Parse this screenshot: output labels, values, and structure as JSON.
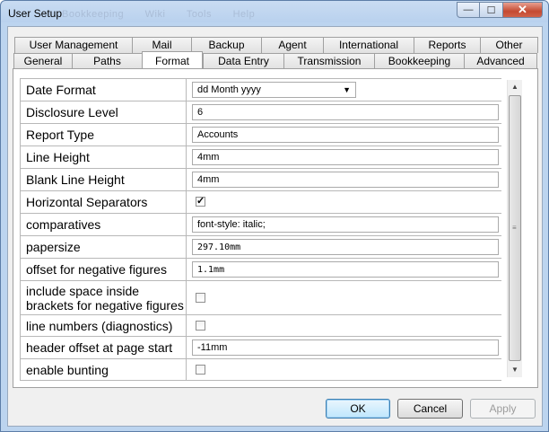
{
  "window": {
    "title": "User Setup",
    "ghost_menu": [
      "Bookkeeping",
      "Wiki",
      "Tools",
      "Help"
    ],
    "buttons": {
      "minimize": "—",
      "maximize": "☐",
      "close": "✕"
    }
  },
  "tabs": {
    "row1": [
      "User   Management",
      "Mail",
      "Backup",
      "Agent",
      "International",
      "Reports",
      "Other"
    ],
    "row2": [
      "General",
      "Paths",
      "Format",
      "Data Entry",
      "Transmission",
      "Bookkeeping",
      "Advanced"
    ],
    "active": "Format"
  },
  "settings": [
    {
      "label": "Date Format",
      "type": "select",
      "value": "dd Month yyyy"
    },
    {
      "label": "Disclosure Level",
      "type": "text",
      "value": "6"
    },
    {
      "label": "Report Type",
      "type": "text",
      "value": "Accounts"
    },
    {
      "label": "Line Height",
      "type": "text",
      "value": "4mm"
    },
    {
      "label": "Blank Line Height",
      "type": "text",
      "value": "4mm"
    },
    {
      "label": "Horizontal Separators",
      "type": "checkbox",
      "checked": true
    },
    {
      "label": "comparatives",
      "type": "text",
      "value": "font-style: italic;"
    },
    {
      "label": "papersize",
      "type": "text",
      "value": "297.10mm"
    },
    {
      "label": "offset for negative figures",
      "type": "text",
      "value": "1.1mm"
    },
    {
      "label": "include space inside brackets for negative figures",
      "type": "checkbox",
      "checked": false
    },
    {
      "label": "line numbers (diagnostics)",
      "type": "checkbox",
      "checked": false
    },
    {
      "label": "header offset at page start",
      "type": "text",
      "value": "-11mm"
    },
    {
      "label": "enable bunting",
      "type": "checkbox",
      "checked": false
    }
  ],
  "footer": {
    "ok": "OK",
    "cancel": "Cancel",
    "apply": "Apply"
  },
  "colors": {
    "title_bar": "#c9dcf2",
    "client": "#f0f0f0",
    "close_button": "#c44a32"
  }
}
